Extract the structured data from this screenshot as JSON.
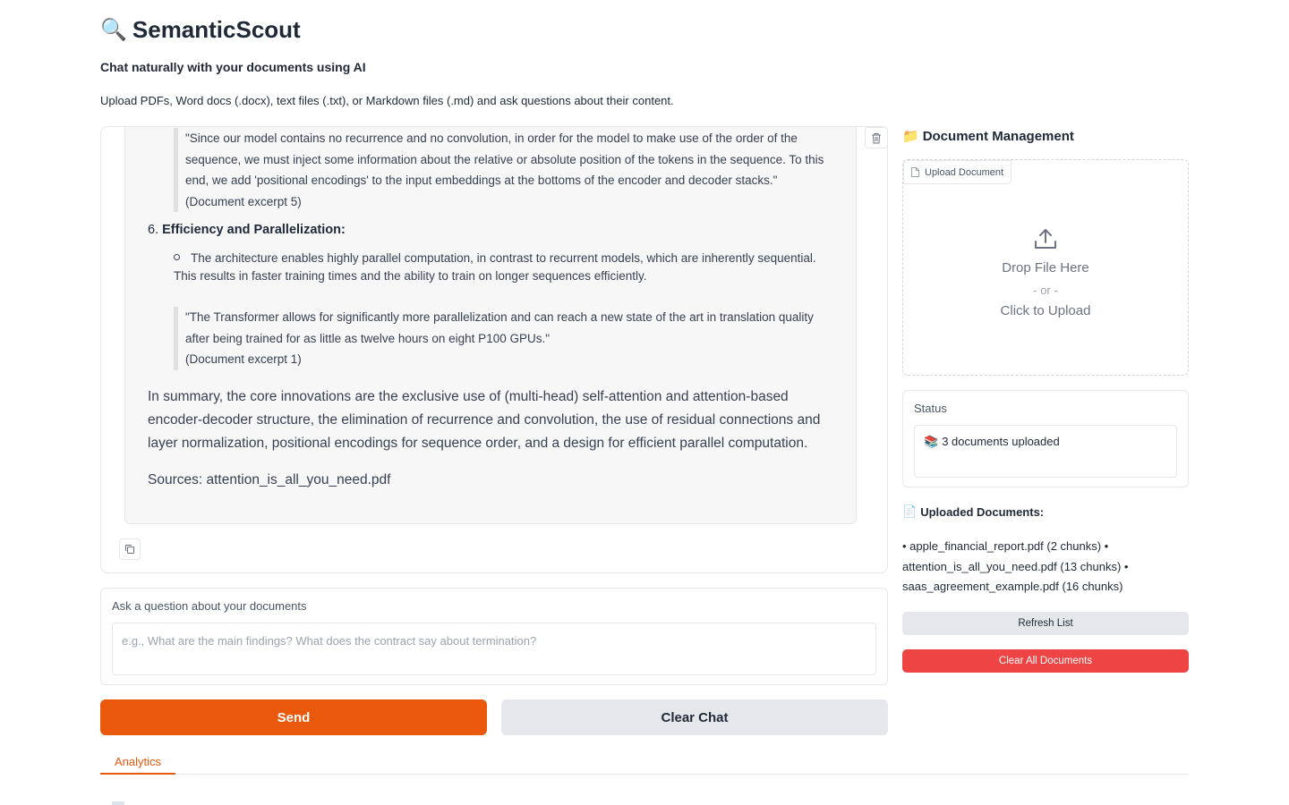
{
  "app": {
    "title": "SemanticScout",
    "title_icon": "magnifier-icon",
    "subtitle": "Chat naturally with your documents using AI",
    "description": "Upload PDFs, Word docs (.docx), text files (.txt), or Markdown files (.md) and ask questions about their content."
  },
  "chat": {
    "message": {
      "quote_1": {
        "text": "\"Since our model contains no recurrence and no convolution, in order for the model to make use of the order of the sequence, we must inject some information about the relative or absolute position of the tokens in the sequence. To this end, we add 'positional encodings' to the input embeddings at the bottoms of the encoder and decoder stacks.\"",
        "source": "(Document excerpt 5)"
      },
      "section_6": {
        "number": "6.",
        "title": "Efficiency and Parallelization:"
      },
      "bullet": "The architecture enables highly parallel computation, in contrast to recurrent models, which are inherently sequential. This results in faster training times and the ability to train on longer sequences efficiently.",
      "quote_2": {
        "text": "\"The Transformer allows for significantly more parallelization and can reach a new state of the art in translation quality after being trained for as little as twelve hours on eight P100 GPUs.\"",
        "source": "(Document excerpt 1)"
      },
      "summary": "In summary, the core innovations are the exclusive use of (multi-head) self-attention and attention-based encoder-decoder structure, the elimination of recurrence and convolution, the use of residual connections and layer normalization, positional encodings for sequence order, and a design for efficient parallel computation.",
      "sources": "Sources: attention_is_all_you_need.pdf"
    },
    "delete_icon": "trash-icon",
    "copy_icon": "copy-icon"
  },
  "question": {
    "label": "Ask a question about your documents",
    "placeholder": "e.g., What are the main findings? What does the contract say about termination?",
    "value": ""
  },
  "buttons": {
    "send": "Send",
    "clear_chat": "Clear Chat",
    "refresh_list": "Refresh List",
    "clear_all_documents": "Clear All Documents"
  },
  "tabs": {
    "analytics": "Analytics"
  },
  "sidebar": {
    "doc_management_title": "Document Management",
    "doc_management_icon": "folder-icon",
    "upload": {
      "label": "Upload Document",
      "drop_text": "Drop File Here",
      "or_text": "- or -",
      "click_text": "Click to Upload"
    },
    "status": {
      "label": "Status",
      "icon": "books-icon",
      "value": "3 documents uploaded"
    },
    "uploaded": {
      "title": "Uploaded Documents:",
      "icon": "document-icon",
      "list_text": "• apple_financial_report.pdf (2 chunks) • attention_is_all_you_need.pdf (13 chunks) • saas_agreement_example.pdf (16 chunks)"
    }
  },
  "colors": {
    "accent": "#ea580c",
    "danger": "#ef4444",
    "neutral_button": "#e5e7eb",
    "message_bg": "#f7f7f8"
  }
}
